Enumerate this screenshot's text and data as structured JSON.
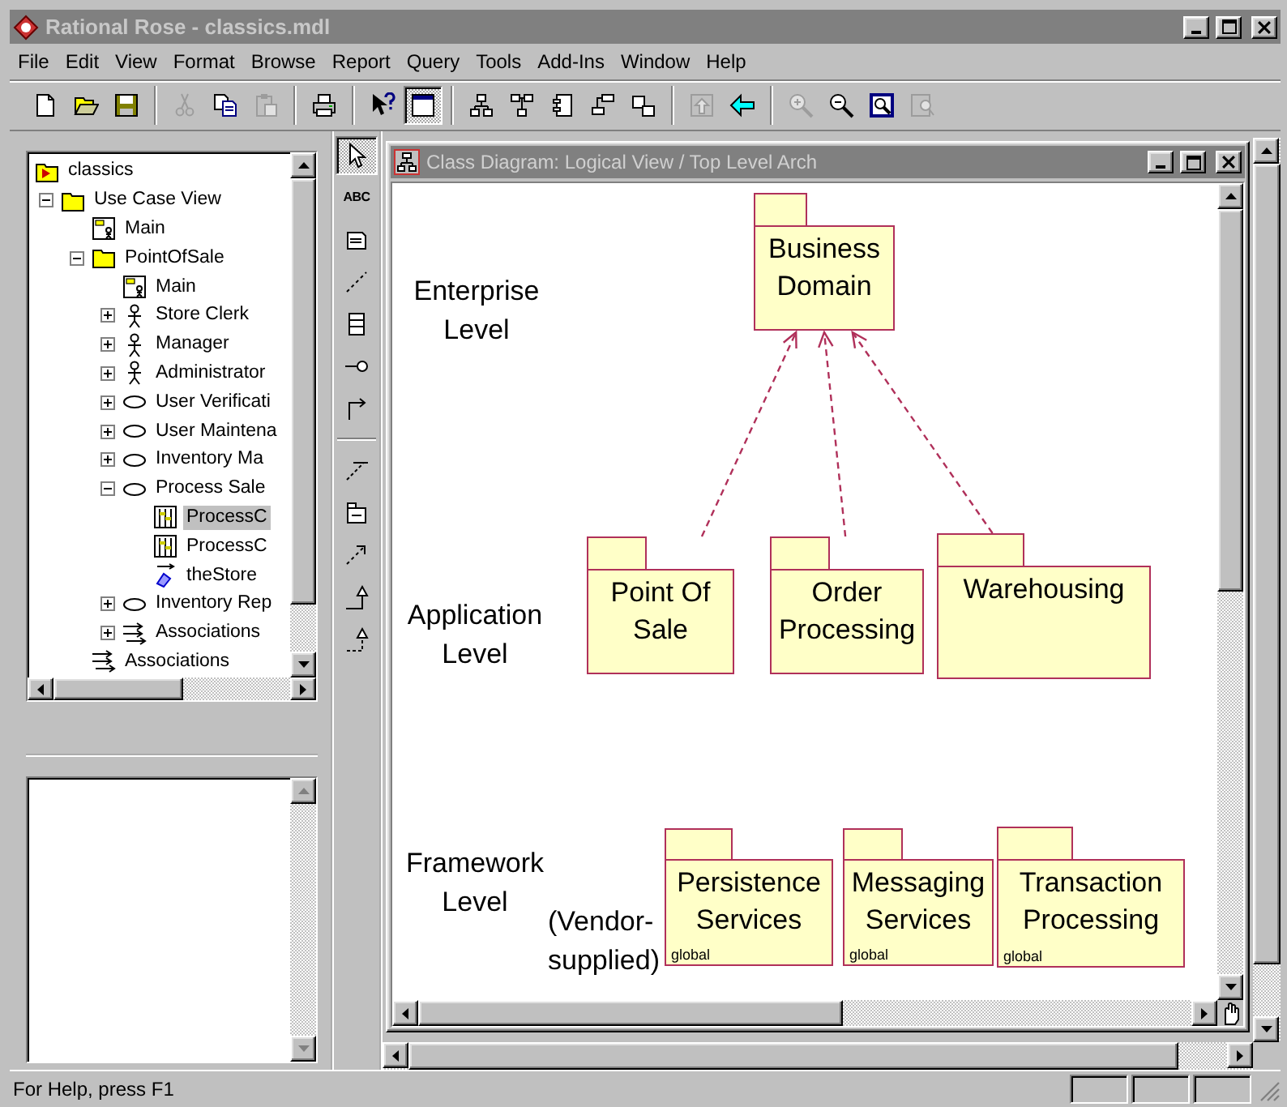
{
  "window": {
    "title": "Rational Rose - classics.mdl"
  },
  "menu": [
    "File",
    "Edit",
    "View",
    "Format",
    "Browse",
    "Report",
    "Query",
    "Tools",
    "Add-Ins",
    "Window",
    "Help"
  ],
  "toolbar": [
    {
      "kind": "new",
      "disabled": false,
      "selected": false
    },
    {
      "kind": "open",
      "disabled": false,
      "selected": false
    },
    {
      "kind": "save",
      "disabled": false,
      "selected": false
    },
    {
      "kind": "separator"
    },
    {
      "kind": "cut",
      "disabled": true,
      "selected": false
    },
    {
      "kind": "copy",
      "disabled": false,
      "selected": false
    },
    {
      "kind": "paste",
      "disabled": true,
      "selected": false
    },
    {
      "kind": "separator"
    },
    {
      "kind": "print",
      "disabled": false,
      "selected": false
    },
    {
      "kind": "separator"
    },
    {
      "kind": "help",
      "disabled": false,
      "selected": false
    },
    {
      "kind": "browser",
      "disabled": false,
      "selected": true
    },
    {
      "kind": "separator"
    },
    {
      "kind": "class-diagram",
      "disabled": false,
      "selected": false
    },
    {
      "kind": "use-case-diagram",
      "disabled": false,
      "selected": false
    },
    {
      "kind": "component-diagram",
      "disabled": false,
      "selected": false
    },
    {
      "kind": "sequence-diagram",
      "disabled": false,
      "selected": false
    },
    {
      "kind": "object-diagram",
      "disabled": false,
      "selected": false
    },
    {
      "kind": "separator"
    },
    {
      "kind": "parent-diagram",
      "disabled": true,
      "selected": false
    },
    {
      "kind": "previous-diagram",
      "disabled": false,
      "selected": false
    },
    {
      "kind": "separator"
    },
    {
      "kind": "zoom-in",
      "disabled": true,
      "selected": false
    },
    {
      "kind": "zoom-out",
      "disabled": false,
      "selected": false
    },
    {
      "kind": "fit",
      "disabled": false,
      "selected": false
    },
    {
      "kind": "undo-fit",
      "disabled": true,
      "selected": false
    }
  ],
  "browser": {
    "tree": [
      {
        "label": "classics",
        "kind": "model",
        "selected": false,
        "children": [
          {
            "label": "Use Case View",
            "kind": "folder",
            "selected": false,
            "expanded": true,
            "children": [
              {
                "label": "Main",
                "kind": "diagram",
                "selected": false
              },
              {
                "label": "PointOfSale",
                "kind": "folder",
                "selected": false,
                "expanded": true,
                "children": [
                  {
                    "label": "Main",
                    "kind": "diagram",
                    "selected": false
                  },
                  {
                    "label": "Store Clerk",
                    "kind": "actor",
                    "selected": false,
                    "expanded": false
                  },
                  {
                    "label": "Manager",
                    "kind": "actor",
                    "selected": false,
                    "expanded": false
                  },
                  {
                    "label": "Administrator",
                    "kind": "actor",
                    "selected": false,
                    "expanded": false
                  },
                  {
                    "label": "User Verificati",
                    "kind": "use-case",
                    "selected": false,
                    "expanded": false
                  },
                  {
                    "label": "User Maintena",
                    "kind": "use-case",
                    "selected": false,
                    "expanded": false
                  },
                  {
                    "label": "Inventory Ma",
                    "kind": "use-case",
                    "selected": false,
                    "expanded": false
                  },
                  {
                    "label": "Process Sale",
                    "kind": "use-case",
                    "selected": false,
                    "expanded": true,
                    "children": [
                      {
                        "label": "ProcessC",
                        "kind": "sequence",
                        "selected": true
                      },
                      {
                        "label": "ProcessC",
                        "kind": "sequence",
                        "selected": false
                      },
                      {
                        "label": "theStore",
                        "kind": "object",
                        "selected": false
                      }
                    ]
                  },
                  {
                    "label": "Inventory Rep",
                    "kind": "use-case",
                    "selected": false,
                    "expanded": false
                  },
                  {
                    "label": "Associations",
                    "kind": "association",
                    "selected": false,
                    "expanded": false
                  }
                ]
              },
              {
                "label": "Associations",
                "kind": "association",
                "selected": false
              }
            ]
          }
        ]
      }
    ]
  },
  "diagram_tools": [
    {
      "kind": "selector",
      "selected": true
    },
    {
      "kind": "text",
      "label": "ABC",
      "selected": false
    },
    {
      "kind": "note",
      "selected": false
    },
    {
      "kind": "anchor",
      "selected": false
    },
    {
      "kind": "class",
      "selected": false
    },
    {
      "kind": "interface",
      "selected": false
    },
    {
      "kind": "association",
      "selected": false
    },
    {
      "kind": "separator"
    },
    {
      "kind": "unidirectional",
      "selected": false
    },
    {
      "kind": "package",
      "selected": false
    },
    {
      "kind": "dependency",
      "selected": false
    },
    {
      "kind": "generalization",
      "selected": false
    },
    {
      "kind": "realization",
      "selected": false
    }
  ],
  "diagram": {
    "title": "Class Diagram: Logical View / Top Level Arch",
    "labels": [
      "Enterprise Level",
      "Application Level",
      "Framework Level",
      "(Vendor-supplied)"
    ],
    "packages": [
      {
        "name": "Business Domain"
      },
      {
        "name": "Point Of Sale"
      },
      {
        "name": "Order Processing"
      },
      {
        "name": "Warehousing"
      },
      {
        "name": "Persistence Services",
        "scope": "global"
      },
      {
        "name": "Messaging Services",
        "scope": "global"
      },
      {
        "name": "Transaction Processing",
        "scope": "global"
      }
    ]
  },
  "status_bar": {
    "text": "For Help, press F1"
  }
}
